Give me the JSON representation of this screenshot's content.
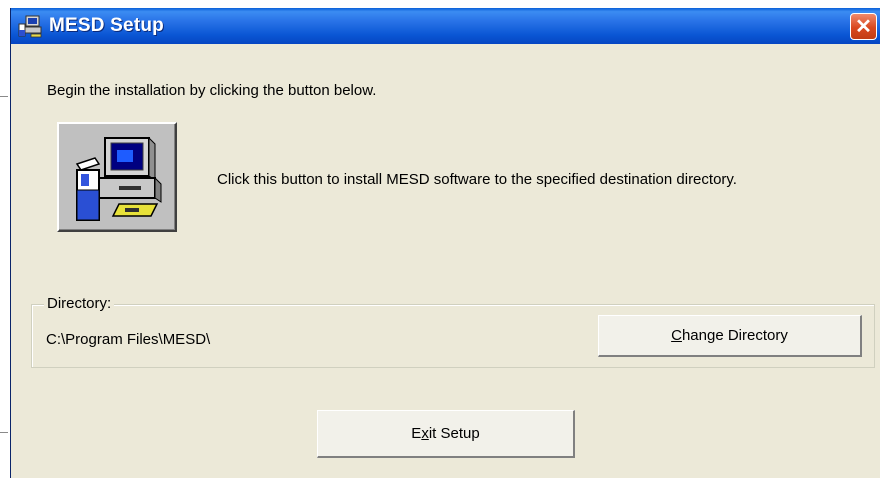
{
  "window": {
    "title": "MESD Setup",
    "close_symbol": "✕"
  },
  "instruction": "Begin the installation by clicking the button below.",
  "install": {
    "icon": "computer-setup-icon",
    "description": "Click this button to install MESD software to the specified destination directory."
  },
  "directory": {
    "group_label": "Directory:",
    "path": "C:\\Program Files\\MESD\\",
    "change_button": {
      "before": "",
      "mnemonic": "C",
      "after": "hange Directory"
    }
  },
  "exit_button": {
    "before": "E",
    "mnemonic": "x",
    "after": "it Setup"
  },
  "colors": {
    "titlebar": "#0a56d4",
    "window_bg": "#ece9d8",
    "close_button": "#d9481f"
  }
}
